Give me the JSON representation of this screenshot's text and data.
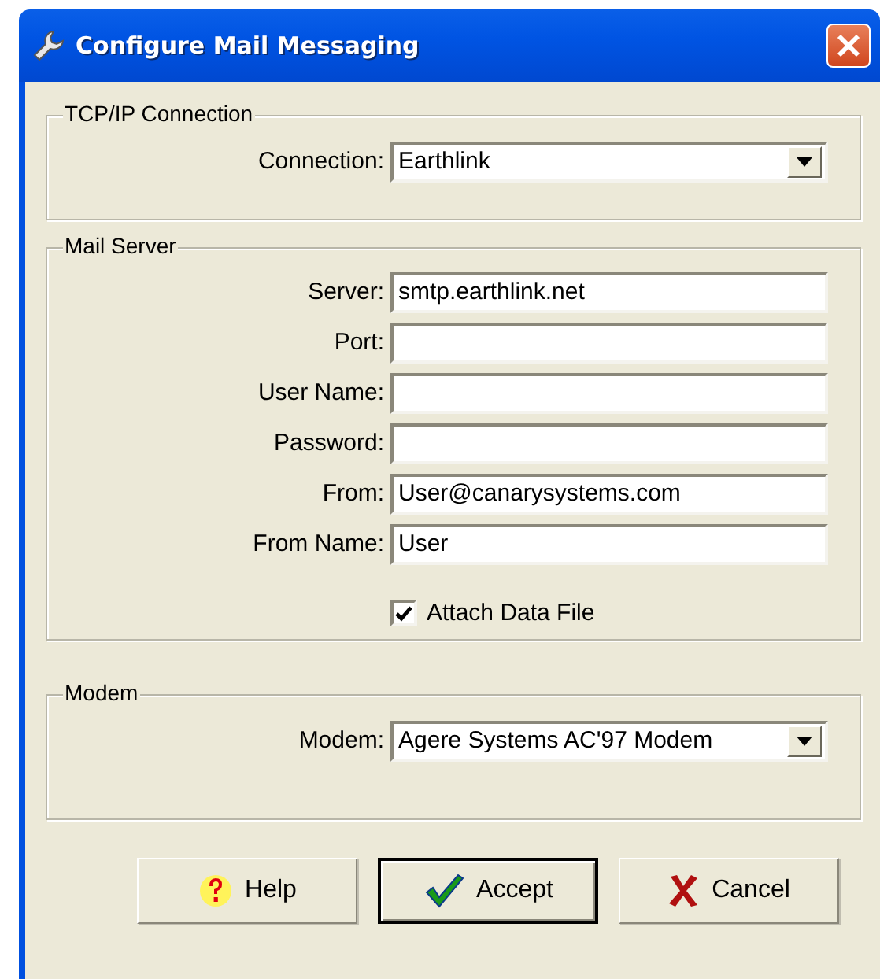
{
  "window": {
    "title": "Configure Mail Messaging"
  },
  "groups": [
    {
      "title": "TCP/IP Connection",
      "fields": [
        {
          "label": "Connection:",
          "kind": "dropdown",
          "value": "Earthlink"
        }
      ]
    },
    {
      "title": "Mail Server",
      "fields": [
        {
          "label": "Server:",
          "kind": "text",
          "value": "smtp.earthlink.net"
        },
        {
          "label": "Port:",
          "kind": "text"
        },
        {
          "label": "User Name:",
          "kind": "text"
        },
        {
          "label": "Password:",
          "kind": "text"
        },
        {
          "label": "From:",
          "kind": "text",
          "value": "User@canarysystems.com"
        },
        {
          "label": "From Name:",
          "kind": "text",
          "value": "User"
        },
        {
          "label": "Attach Data File",
          "kind": "checkbox",
          "checked": true
        }
      ]
    },
    {
      "title": "Modem",
      "fields": [
        {
          "label": "Modem:",
          "kind": "dropdown",
          "value": "Agere Systems AC'97 Modem"
        }
      ]
    }
  ],
  "buttons": [
    {
      "label": "Help",
      "kind": "help",
      "default": false
    },
    {
      "label": "Accept",
      "kind": "accept",
      "default": true
    },
    {
      "label": "Cancel",
      "kind": "cancel",
      "default": false
    }
  ]
}
